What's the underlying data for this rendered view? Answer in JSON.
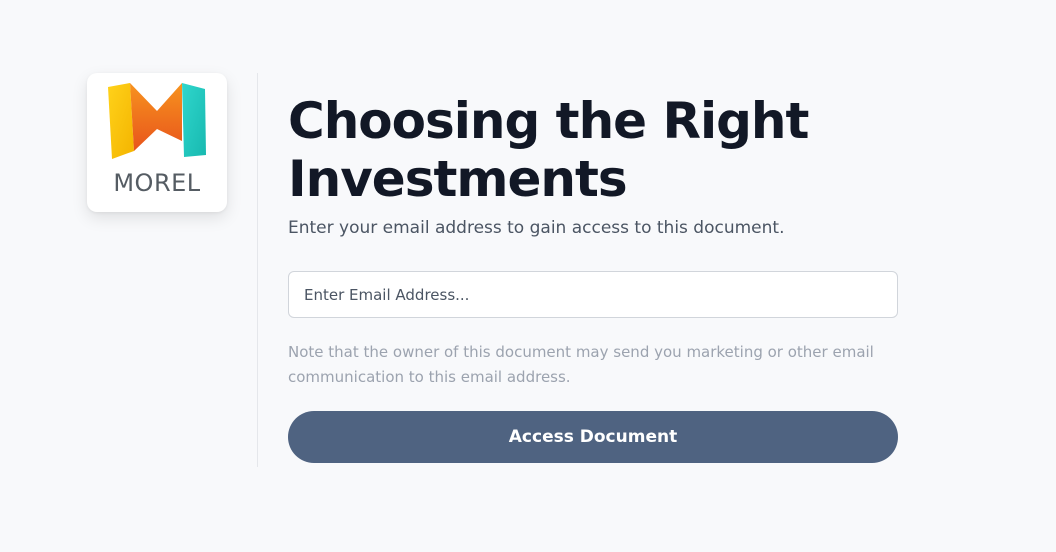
{
  "logo": {
    "text": "MOREL",
    "icon": "morel-m-logo-icon",
    "colors": {
      "left": "#f5c400",
      "center": "#f26522",
      "right": "#1ec8c8"
    }
  },
  "main": {
    "title": "Choosing the Right Investments",
    "subtitle": "Enter your email address to gain access to this document.",
    "email_placeholder": "Enter Email Address...",
    "note": "Note that the owner of this document may send you marketing or other email communication to this email address.",
    "button_label": "Access Document"
  },
  "colors": {
    "background": "#f8f9fb",
    "title": "#121826",
    "button": "#4f6381"
  }
}
